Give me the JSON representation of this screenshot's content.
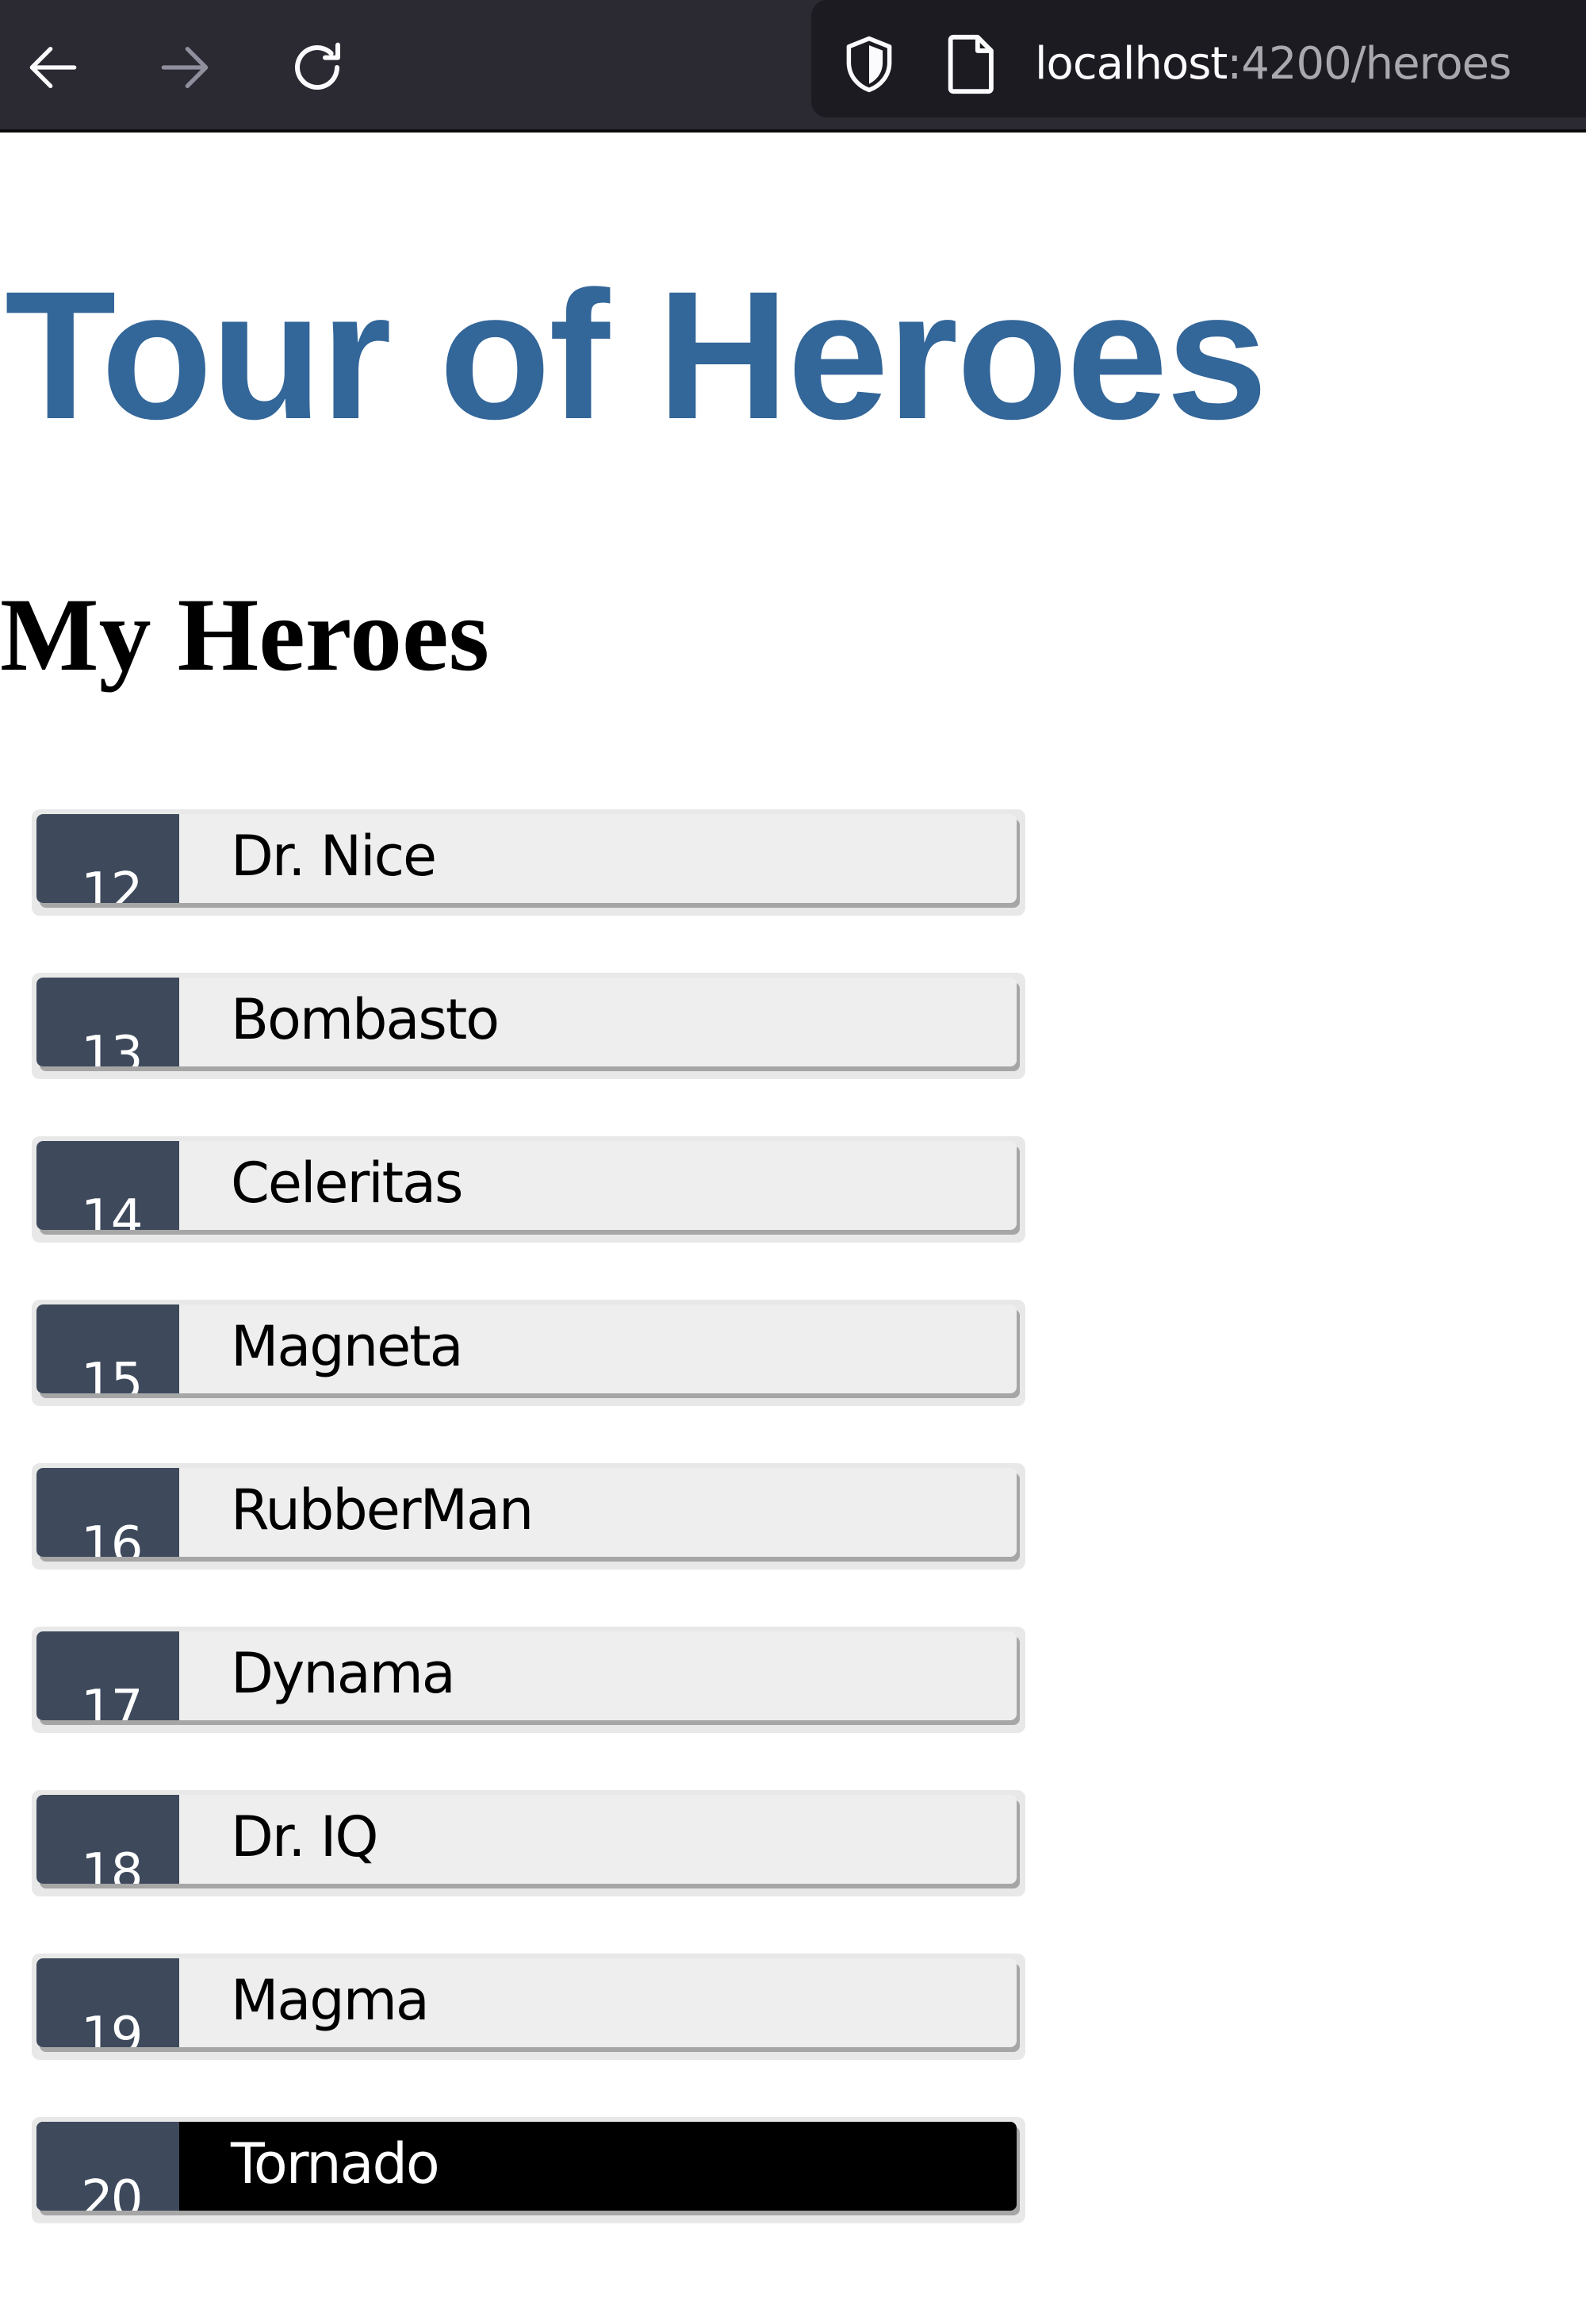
{
  "browser": {
    "url_host": "localhost",
    "url_rest": ":4200/heroes",
    "toolbar_color": "#2b2a33",
    "icons": [
      "back-arrow-icon",
      "forward-arrow-icon",
      "reload-icon",
      "shield-icon",
      "page-icon"
    ]
  },
  "app": {
    "title": "Tour of Heroes",
    "title_color": "#336699"
  },
  "heroes_section": {
    "title": "My Heroes",
    "badge_color": "#3e4a5c",
    "selected_color": "#000000",
    "items": [
      {
        "id": "12",
        "name": "Dr. Nice",
        "selected": false
      },
      {
        "id": "13",
        "name": "Bombasto",
        "selected": false
      },
      {
        "id": "14",
        "name": "Celeritas",
        "selected": false
      },
      {
        "id": "15",
        "name": "Magneta",
        "selected": false
      },
      {
        "id": "16",
        "name": "RubberMan",
        "selected": false
      },
      {
        "id": "17",
        "name": "Dynama",
        "selected": false
      },
      {
        "id": "18",
        "name": "Dr. IQ",
        "selected": false
      },
      {
        "id": "19",
        "name": "Magma",
        "selected": false
      },
      {
        "id": "20",
        "name": "Tornado",
        "selected": true
      }
    ]
  }
}
